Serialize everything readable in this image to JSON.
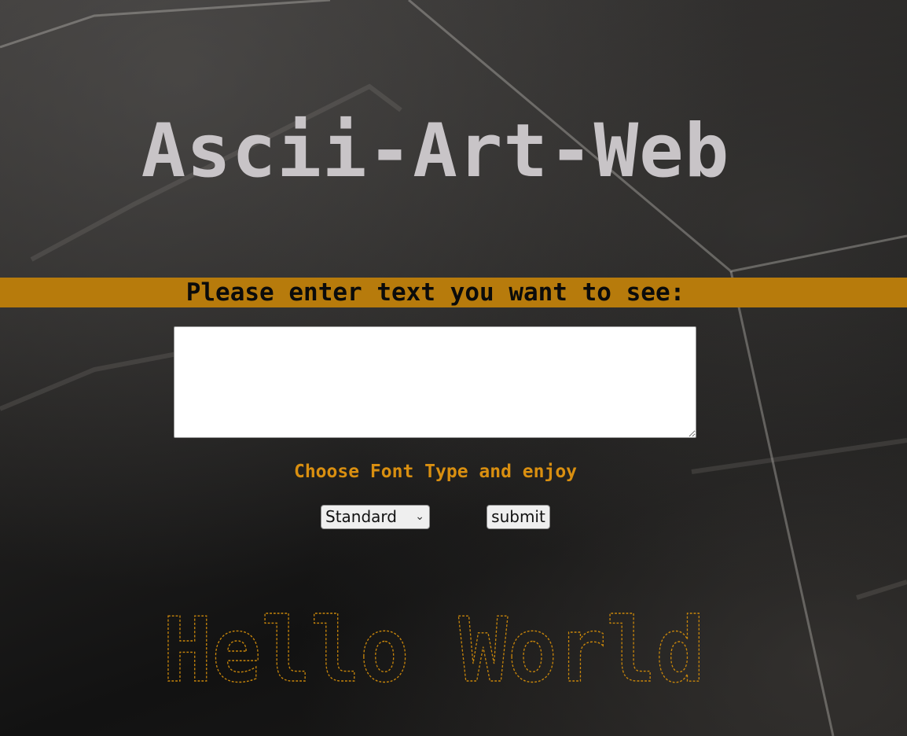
{
  "header": {
    "title": "Ascii-Art-Web"
  },
  "form": {
    "prompt": "Please enter text you want to see:",
    "text_value": "",
    "font_hint": "Choose Font Type and enjoy",
    "font_select": {
      "selected": "Standard"
    },
    "submit_label": "submit"
  },
  "output": {
    "text": "Hello World",
    "color": "#c8860b"
  },
  "colors": {
    "accent": "#b77b0c",
    "title": "#c8c4c7",
    "hint": "#d98f10"
  }
}
